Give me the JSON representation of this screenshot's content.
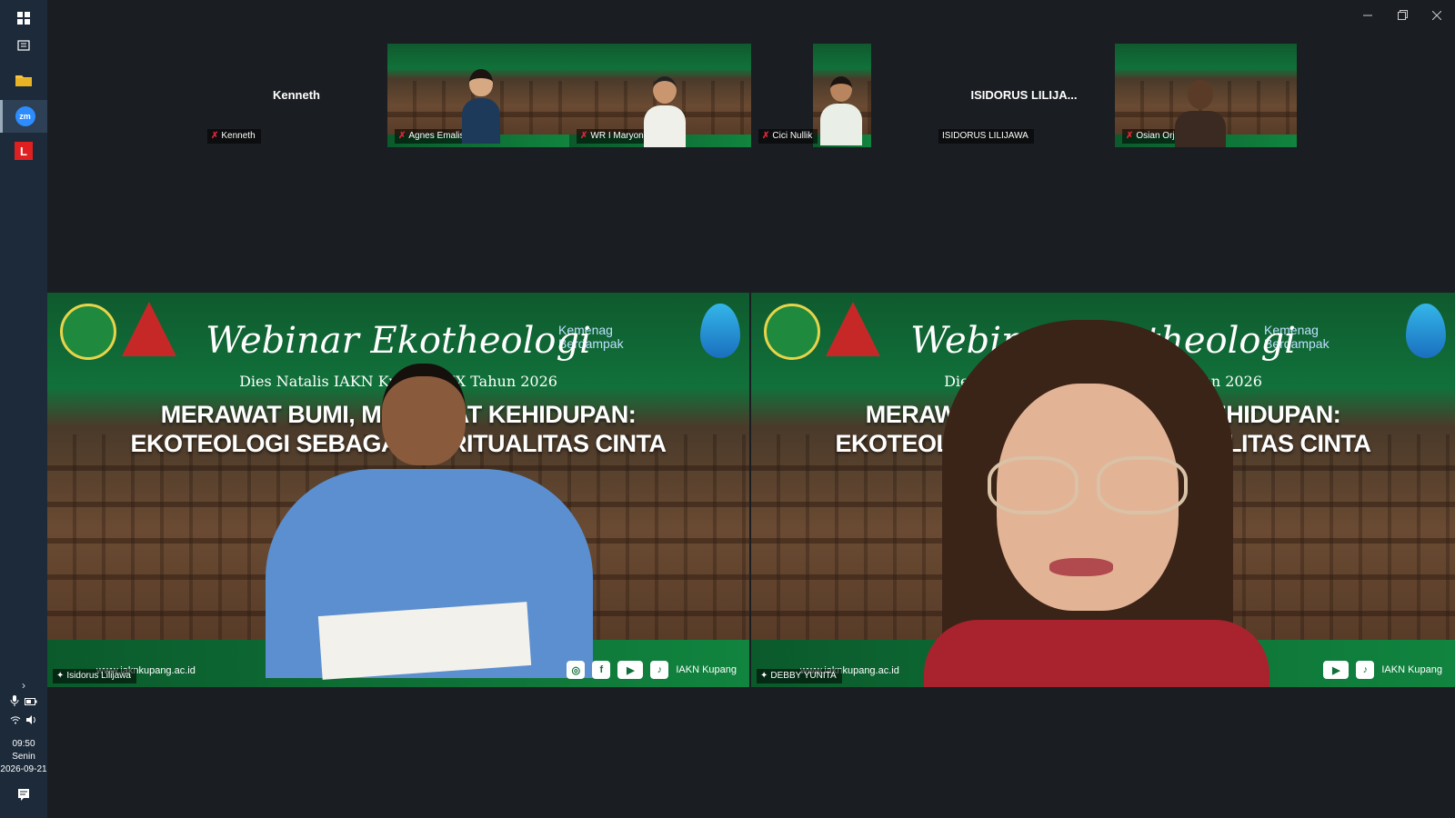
{
  "taskbar": {
    "items": [
      {
        "icon": "windows-start-icon"
      },
      {
        "icon": "task-view-icon"
      },
      {
        "icon": "file-explorer-icon"
      },
      {
        "icon": "zoom-app-icon",
        "label": "zm",
        "active": true
      },
      {
        "icon": "red-l-app-icon",
        "label": "L"
      }
    ],
    "clock": {
      "time": "09:50",
      "day": "Senin",
      "date": "2026-09-21"
    }
  },
  "gallery": [
    {
      "type": "name",
      "display_name": "Kenneth",
      "label": "Kenneth",
      "muted": true
    },
    {
      "type": "video",
      "label": "Agnes Emalisa",
      "muted": true
    },
    {
      "type": "video",
      "label": "WR I Maryon Dan",
      "muted": true
    },
    {
      "type": "video",
      "label": "Cici Nullik",
      "muted": true
    },
    {
      "type": "name",
      "display_name": "ISIDORUS LILIJA...",
      "label": "ISIDORUS LILIJAWA",
      "muted": false
    },
    {
      "type": "video",
      "label": "Osian Orjumi Moru",
      "muted": true
    }
  ],
  "speakers": [
    {
      "label": "Isidorus Lilijawa",
      "active": false
    },
    {
      "label": "DEBBY YUNITA",
      "active": true
    }
  ],
  "banner": {
    "title": "Webinar Ekotheologi",
    "subtitle": "Dies Natalis IAKN Kupang XIX Tahun 2026",
    "headline_1": "MERAWAT BUMI, MERAWAT KEHIDUPAN:",
    "headline_2": "EKOTEOLOGI SEBAGAI SPIRITUALITAS CINTA",
    "kemenag_1": "Kemenag",
    "kemenag_2": "Berdampak",
    "url": "www.iaknkupang.ac.id",
    "handle": "IAKN Kupang"
  },
  "colors": {
    "active_border": "#2fd27a",
    "mute": "#e0263a",
    "banner_green": "#11703a"
  }
}
